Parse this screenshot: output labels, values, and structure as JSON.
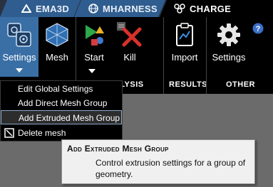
{
  "tabs": [
    {
      "label": "EMA3D",
      "icon": "ema3d-icon"
    },
    {
      "label": "MHARNESS",
      "icon": "globe-icon"
    },
    {
      "label": "CHARGE",
      "icon": "charge-icon",
      "active": true
    }
  ],
  "ribbon": {
    "buttons": [
      {
        "label": "Settings",
        "icon": "settings-stack-icon",
        "has_dropdown": true,
        "pressed": true
      },
      {
        "label": "Mesh",
        "icon": "mesh-icon"
      },
      {
        "label": "Start",
        "icon": "start-icon",
        "has_dropdown": true
      },
      {
        "label": "Kill",
        "icon": "kill-icon"
      },
      {
        "label": "Import",
        "icon": "import-icon"
      },
      {
        "label": "Settings",
        "icon": "gear-icon"
      }
    ],
    "groups": {
      "analysis": "ANALYSIS",
      "results": "RESULTS",
      "other": "OTHER"
    },
    "help_icon": "help-icon"
  },
  "menu": {
    "items": [
      {
        "label": "Edit Global Settings"
      },
      {
        "label": "Add Direct Mesh Group"
      },
      {
        "label": "Add Extruded Mesh Group",
        "highlighted": true
      },
      {
        "label": "Delete mesh",
        "icon": "delete-mesh-icon"
      }
    ]
  },
  "tooltip": {
    "title": "Add Extruded Mesh Group",
    "body": "Control extrusion settings for a group of geometry."
  },
  "colors": {
    "ribbon_bg": "#000000",
    "tab_inactive": "#2f5d8f",
    "pressed_button": "#3a6fa6",
    "tooltip_bg": "#f0f0f0",
    "workspace": "#6b6b6b"
  }
}
